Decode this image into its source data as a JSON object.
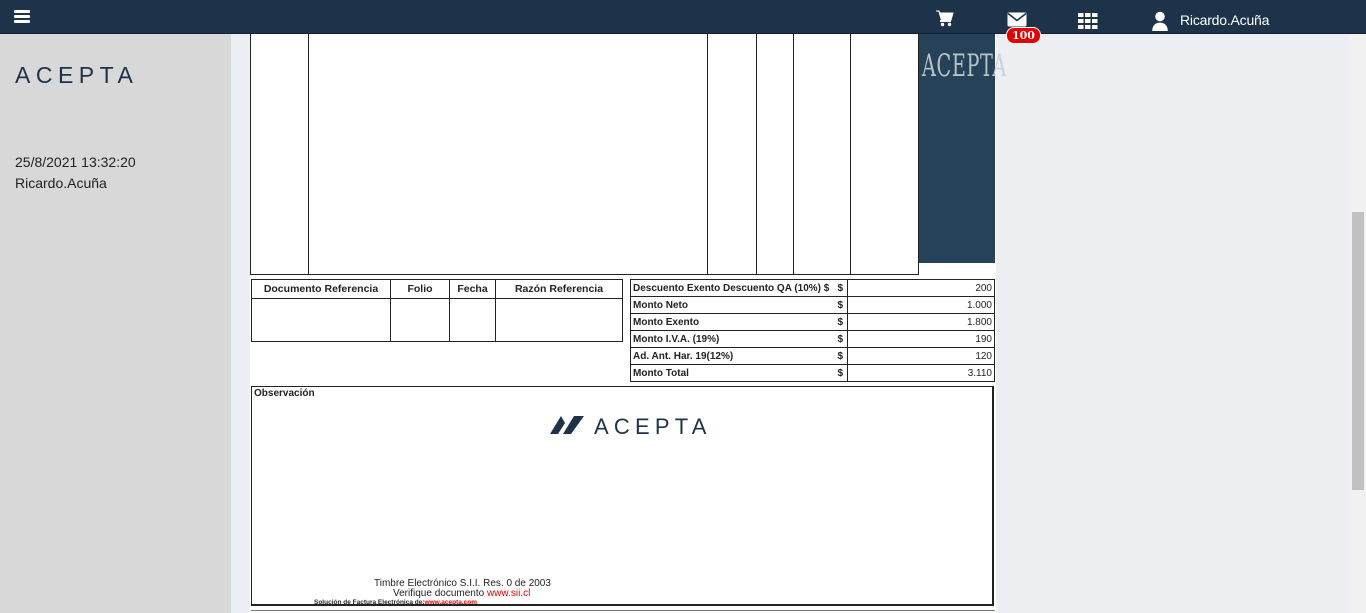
{
  "topbar": {
    "menu_icon": "hamburger-icon",
    "cart_icon": "cart-icon",
    "mail_icon": "envelope-icon",
    "mail_badge": "100",
    "apps_icon": "grid-icon",
    "user_icon": "user-icon",
    "user_name": "Ricardo.Acuña",
    "colors": {
      "bar": "#1d3349",
      "badge": "#e60000"
    }
  },
  "sidebar": {
    "logo": "ACEPTA",
    "datetime": "25/8/2021 13:32:20",
    "user": "Ricardo.Acuña"
  },
  "document": {
    "banner_logo": "ACEPTA",
    "references": {
      "headers": [
        "Documento Referencia",
        "Folio",
        "Fecha",
        "Razón Referencia"
      ]
    },
    "totals": [
      {
        "label": "Descuento Exento Descuento QA (10%) $",
        "currency": "$",
        "value": "200"
      },
      {
        "label": "Monto Neto",
        "currency": "$",
        "value": "1.000"
      },
      {
        "label": "Monto Exento",
        "currency": "$",
        "value": "1.800"
      },
      {
        "label": "Monto I.V.A. (19%)",
        "currency": "$",
        "value": "190"
      },
      {
        "label": "Ad. Ant. Har. 19(12%)",
        "currency": "$",
        "value": "120"
      },
      {
        "label": "Monto Total",
        "currency": "$",
        "value": "3.110"
      }
    ],
    "observacion_label": "Observación",
    "obs_logo": "ACEPTA",
    "timbre": "Timbre Electrónico S.I.I.  Res. 0 de 2003",
    "verifique_label": "Verifique documento",
    "verifique_link": "www.sii.cl",
    "solucion_label": "Solución de Factura Electrónica de:",
    "solucion_link": "www.acepta.com"
  }
}
